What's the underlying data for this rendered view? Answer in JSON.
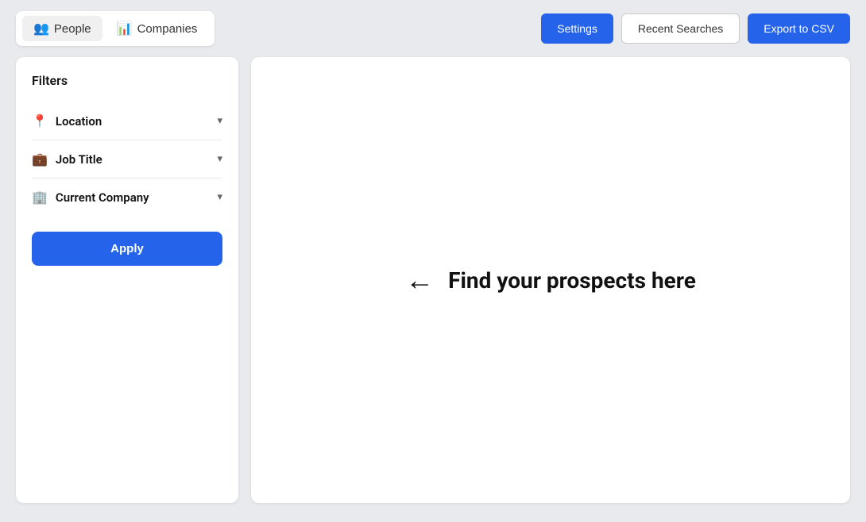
{
  "header": {
    "tabs": [
      {
        "id": "people",
        "label": "People",
        "icon": "👥",
        "active": true
      },
      {
        "id": "companies",
        "label": "Companies",
        "icon": "📊",
        "active": false
      }
    ],
    "actions": [
      {
        "id": "settings",
        "label": "Settings",
        "primary": true
      },
      {
        "id": "recent-searches",
        "label": "Recent Searches",
        "primary": false
      },
      {
        "id": "export-csv",
        "label": "Export to CSV",
        "primary": true
      }
    ]
  },
  "filters": {
    "title": "Filters",
    "items": [
      {
        "id": "location",
        "label": "Location",
        "icon": "📍"
      },
      {
        "id": "job-title",
        "label": "Job Title",
        "icon": "💼"
      },
      {
        "id": "current-company",
        "label": "Current Company",
        "icon": "🏢"
      }
    ],
    "apply_label": "Apply"
  },
  "results": {
    "empty_state_text": "Find your prospects here",
    "arrow": "←"
  }
}
